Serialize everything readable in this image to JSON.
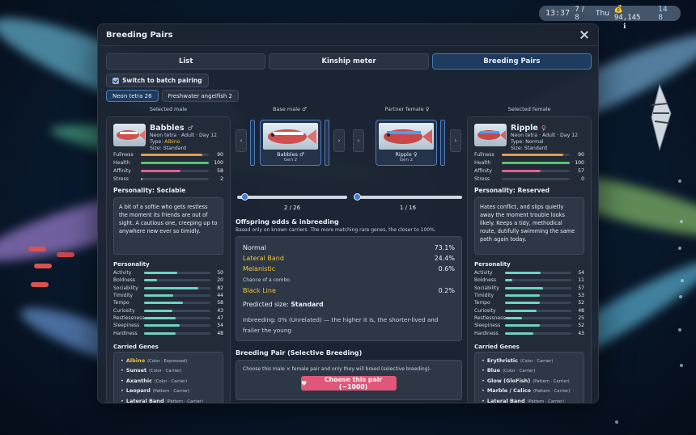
{
  "hud": {
    "clock": "13:37",
    "date": "7 / 8",
    "weekday": "Thu",
    "coins": "94,145",
    "coin_suffix": "14 8",
    "sub": "ℹ"
  },
  "modal": {
    "title": "Breeding Pairs"
  },
  "tabs": [
    {
      "label": "List",
      "active": false
    },
    {
      "label": "Kinship meter",
      "active": false
    },
    {
      "label": "Breeding Pairs",
      "active": true
    }
  ],
  "batch_label": "Switch to batch pairing",
  "species": [
    {
      "label": "Neon tetra 26",
      "active": true
    },
    {
      "label": "Freshwater angelfish 2",
      "active": false
    }
  ],
  "columns": {
    "selected_male": "Selected male",
    "base_male": "Base male ♂",
    "partner_female": "Partner female ♀",
    "selected_female": "Selected female"
  },
  "male": {
    "name": "Babbles",
    "gender": "♂",
    "line1": "Neon tetra · Adult · Day 12",
    "type_prefix": "Type: ",
    "type": "Albino",
    "size": "Size: Standard",
    "stats": [
      {
        "label": "Fullness",
        "value": 90,
        "color": "#e89a4a"
      },
      {
        "label": "Health",
        "value": 100,
        "color": "#58c46e"
      },
      {
        "label": "Affinity",
        "value": 58,
        "color": "#e55d95"
      },
      {
        "label": "Stress",
        "value": 2,
        "color": "#9aa6b8"
      }
    ],
    "personality_title": "Personality: Sociable",
    "personality_text": "A bit of a softie who gets restless the moment its friends are out of sight. A cautious one, creeping up to anywhere new ever so timidly.",
    "traits": [
      {
        "label": "Activity",
        "value": 50
      },
      {
        "label": "Boldness",
        "value": 20
      },
      {
        "label": "Sociability",
        "value": 82
      },
      {
        "label": "Timidity",
        "value": 44
      },
      {
        "label": "Tempo",
        "value": 58
      },
      {
        "label": "Curiosity",
        "value": 43
      },
      {
        "label": "Restlessness",
        "value": 47
      },
      {
        "label": "Sleepiness",
        "value": 54
      },
      {
        "label": "Hardiness",
        "value": 48
      }
    ],
    "genes": [
      {
        "name": "Albino",
        "tag": "(Color · Expressed)",
        "accent": true
      },
      {
        "name": "Sunset",
        "tag": "(Color · Carrier)",
        "accent": false
      },
      {
        "name": "Axanthic",
        "tag": "(Color · Carrier)",
        "accent": false
      },
      {
        "name": "Leopard",
        "tag": "(Pattern · Carrier)",
        "accent": false
      },
      {
        "name": "Lateral Band",
        "tag": "(Pattern · Carrier)",
        "accent": false
      }
    ]
  },
  "female": {
    "name": "Ripple",
    "gender": "♀",
    "line1": "Neon tetra · Adult · Day 12",
    "type_prefix": "Type: ",
    "type": "Normal",
    "size": "Size: Standard",
    "stats": [
      {
        "label": "Fullness",
        "value": 90,
        "color": "#e89a4a"
      },
      {
        "label": "Health",
        "value": 100,
        "color": "#58c46e"
      },
      {
        "label": "Affinity",
        "value": 57,
        "color": "#e55d95"
      },
      {
        "label": "Stress",
        "value": 0,
        "color": "#9aa6b8"
      }
    ],
    "personality_title": "Personality: Reserved",
    "personality_text": "Hates conflict, and slips quietly away the moment trouble looks likely. Keeps a tidy, methodical route, dutifully swimming the same path again today.",
    "traits": [
      {
        "label": "Activity",
        "value": 54
      },
      {
        "label": "Boldness",
        "value": 11
      },
      {
        "label": "Sociability",
        "value": 57
      },
      {
        "label": "Timidity",
        "value": 53
      },
      {
        "label": "Tempo",
        "value": 52
      },
      {
        "label": "Curiosity",
        "value": 48
      },
      {
        "label": "Restlessness",
        "value": 25
      },
      {
        "label": "Sleepiness",
        "value": 52
      },
      {
        "label": "Hardiness",
        "value": 43
      }
    ],
    "genes": [
      {
        "name": "Erythristic",
        "tag": "(Color · Carrier)",
        "accent": false
      },
      {
        "name": "Blue",
        "tag": "(Color · Carrier)",
        "accent": false
      },
      {
        "name": "Glow (GloFish)",
        "tag": "(Pattern · Carrier)",
        "accent": false
      },
      {
        "name": "Marble / Calico",
        "tag": "(Pattern · Carrier)",
        "accent": false
      },
      {
        "name": "Lateral Band",
        "tag": "(Pattern · Carrier)",
        "accent": false
      }
    ]
  },
  "personality_label": "Personality",
  "carried_genes_label": "Carried Genes",
  "base_card": {
    "name": "Babbles ♂",
    "gen": "Gen 2"
  },
  "partner_card": {
    "name": "Ripple ♀",
    "gen": "Gen 2"
  },
  "male_slider": {
    "label": "2 / 26",
    "position": 2,
    "total": 26
  },
  "female_slider": {
    "label": "1 / 16",
    "position": 1,
    "total": 16
  },
  "odds": {
    "title": "Offspring odds & inbreeding",
    "subtitle": "Based only on known carriers. The more matching rare genes, the closer to 100%.",
    "rows": [
      {
        "name": "Normal",
        "value": "73.1%",
        "accent": false
      },
      {
        "name": "Lateral Band",
        "value": "24.4%",
        "accent": true
      },
      {
        "name": "Melanistic",
        "value": "0.6%",
        "accent": true
      }
    ],
    "combo_title": "Chance of a combo",
    "combo_rows": [
      {
        "name": "Black Line",
        "value": "0.2%",
        "accent": true
      }
    ],
    "predicted_label": "Predicted size: ",
    "predicted_value": "Standard",
    "inbreeding": "Inbreeding: 0% (Unrelated) — the higher it is, the shorter-lived and frailer the young"
  },
  "pair": {
    "title": "Breeding Pair (Selective Breeding)",
    "desc": "Choose this male × female pair and only they will breed (selective breeding).",
    "button": "Choose this pair (−1000)"
  }
}
